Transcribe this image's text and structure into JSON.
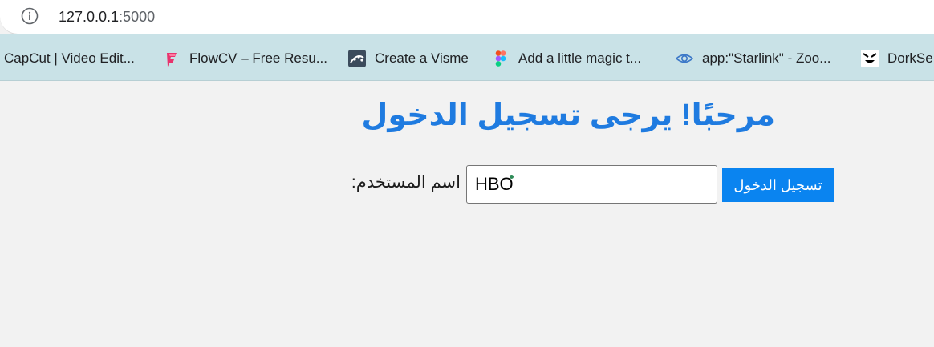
{
  "browser": {
    "url_host": "127.0.0.1",
    "url_port": ":5000"
  },
  "bookmarks": [
    {
      "label": "CapCut | Video Edit...",
      "icon": "capcut-icon"
    },
    {
      "label": "FlowCV – Free Resu...",
      "icon": "flowcv-icon"
    },
    {
      "label": "Create a Visme",
      "icon": "visme-icon"
    },
    {
      "label": "Add a little magic t...",
      "icon": "figma-icon"
    },
    {
      "label": "app:\"Starlink\" - Zoo...",
      "icon": "eye-icon"
    },
    {
      "label": "DorkSe",
      "icon": "dorkse-icon"
    }
  ],
  "page": {
    "heading": "مرحبًا! يرجى تسجيل الدخول",
    "username_label": "اسم المستخدم:",
    "username_value": "HBO",
    "login_button": "تسجيل الدخول"
  },
  "colors": {
    "heading": "#1f7be0",
    "button": "#0a84f0",
    "bookmarks_bar": "#c9e2e7",
    "page_background": "#f2f2f2"
  }
}
